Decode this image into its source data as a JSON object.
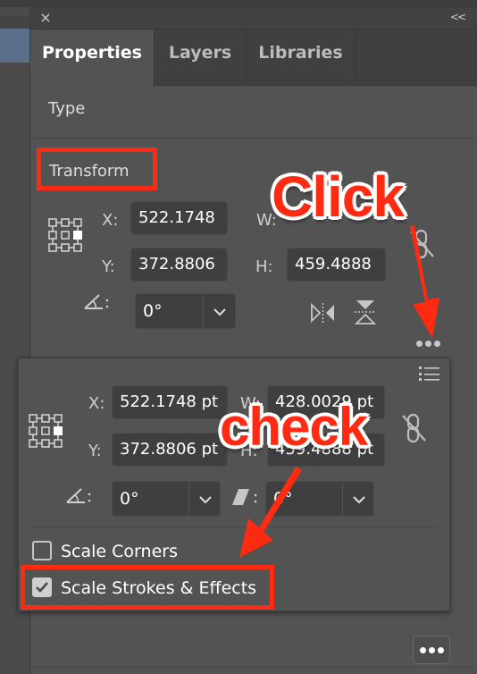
{
  "panel": {
    "close_icon": "×",
    "collapse_icon": "<<",
    "tabs": [
      {
        "label": "Properties",
        "active": true
      },
      {
        "label": "Layers",
        "active": false
      },
      {
        "label": "Libraries",
        "active": false
      }
    ]
  },
  "sections": {
    "type_title": "Type",
    "transform_title": "Transform"
  },
  "transform": {
    "x_label": "X:",
    "x_value": "522.1748",
    "y_label": "Y:",
    "y_value": "372.8806",
    "w_label": "W:",
    "h_label": "H:",
    "h_value": "459.4888",
    "angle_label": ":",
    "angle_value": "0°"
  },
  "popup": {
    "x_label": "X:",
    "x_value": "522.1748 pt",
    "y_label": "Y:",
    "y_value": "372.8806 pt",
    "w_label": "W:",
    "w_value": "428.0029 pt",
    "h_label": "H:",
    "h_value": "459.4888 pt",
    "angle_label": ":",
    "angle_value": "0°",
    "shear_label": ":",
    "shear_value": "0°",
    "options": [
      {
        "label": "Scale Corners",
        "checked": false
      },
      {
        "label": "Scale Strokes & Effects",
        "checked": true
      }
    ]
  },
  "annotations": {
    "click": "Click",
    "check": "check",
    "color": "#ff2a12"
  },
  "colors": {
    "panel_bg": "#535353",
    "tabbar_bg": "#404040",
    "field_bg": "#3f3f3f"
  }
}
